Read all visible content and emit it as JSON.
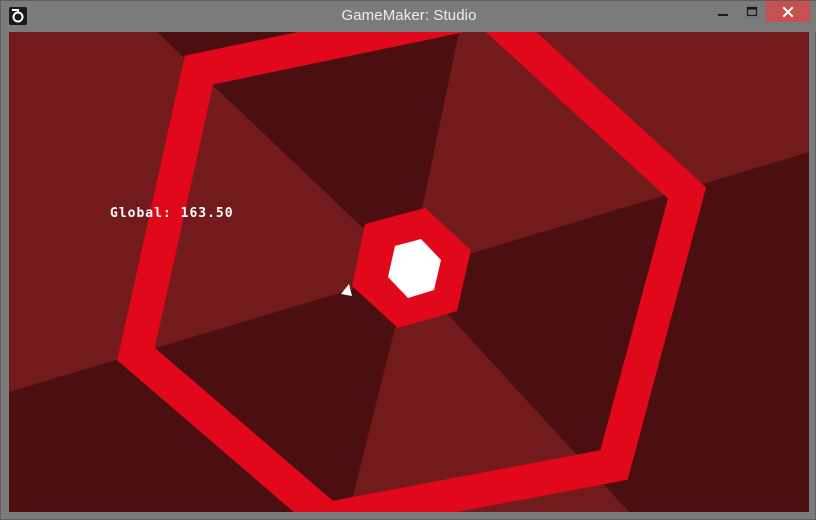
{
  "window": {
    "title": "GameMaker: Studio",
    "icons": {
      "app": "gamemaker-icon",
      "minimize": "minimize-icon",
      "maximize": "maximize-icon",
      "close": "close-icon"
    }
  },
  "game": {
    "hud": {
      "global_text": "Global: 163.50"
    },
    "colors": {
      "background_light": "#721a1c",
      "background_dark": "#4b0f11",
      "wall": "#e0081a",
      "center_cap": "#ffffff",
      "player": "#ffffff",
      "titlebar": "#7b7b7b",
      "close_button": "#c75050"
    }
  }
}
